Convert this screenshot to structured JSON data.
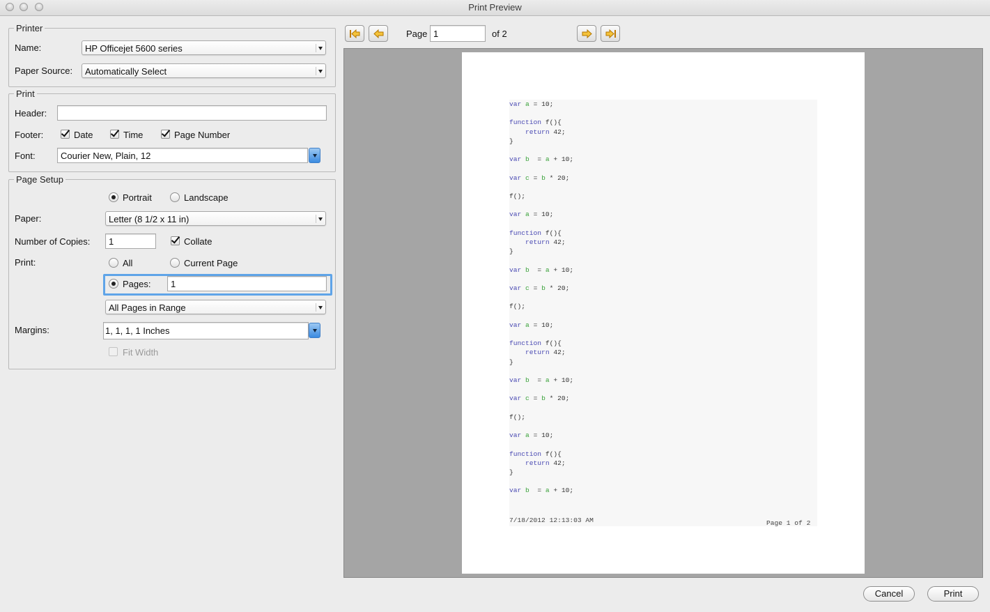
{
  "window": {
    "title": "Print Preview"
  },
  "printer": {
    "group_title": "Printer",
    "name_label": "Name:",
    "name_value": "HP Officejet 5600 series",
    "source_label": "Paper Source:",
    "source_value": "Automatically Select"
  },
  "print_group": {
    "group_title": "Print",
    "header_label": "Header:",
    "header_value": "",
    "footer_label": "Footer:",
    "footer_date": {
      "label": "Date",
      "checked": true
    },
    "footer_time": {
      "label": "Time",
      "checked": true
    },
    "footer_page_number": {
      "label": "Page Number",
      "checked": true
    },
    "font_label": "Font:",
    "font_value": "Courier New, Plain, 12"
  },
  "page_setup": {
    "group_title": "Page Setup",
    "orientation": {
      "portrait": "Portrait",
      "landscape": "Landscape",
      "selected": "Portrait"
    },
    "paper_label": "Paper:",
    "paper_value": "Letter (8 1/2 x 11 in)",
    "copies_label": "Number of Copies:",
    "copies_value": "1",
    "collate": {
      "label": "Collate",
      "checked": true
    },
    "print_label": "Print:",
    "range_all": "All",
    "range_current": "Current Page",
    "range_pages": "Pages:",
    "range_selected": "Pages",
    "pages_value": "1",
    "subset_value": "All Pages in Range",
    "margins_label": "Margins:",
    "margins_value": "1, 1, 1, 1 Inches",
    "fit_width": {
      "label": "Fit Width",
      "checked": false,
      "enabled": false
    }
  },
  "navigation": {
    "page_label": "Page",
    "page_value": "1",
    "of_label": "of 2",
    "icons": [
      "first-page-icon",
      "previous-page-icon",
      "next-page-icon",
      "last-page-icon"
    ]
  },
  "preview": {
    "lines": [
      "var a = 10;",
      "",
      "function f(){",
      "    return 42;",
      "}",
      "",
      "var b  = a + 10;",
      "",
      "var c = b * 20;",
      "",
      "f();",
      "",
      "var a = 10;",
      "",
      "function f(){",
      "    return 42;",
      "}",
      "",
      "var b  = a + 10;",
      "",
      "var c = b * 20;",
      "",
      "f();",
      "",
      "var a = 10;",
      "",
      "function f(){",
      "    return 42;",
      "}",
      "",
      "var b  = a + 10;",
      "",
      "var c = b * 20;",
      "",
      "f();",
      "",
      "var a = 10;",
      "",
      "function f(){",
      "    return 42;",
      "}",
      "",
      "var b  = a + 10;"
    ],
    "footer_left": "7/18/2012 12:13:03 AM",
    "footer_right": "Page 1 of 2"
  },
  "buttons": {
    "cancel": "Cancel",
    "print": "Print"
  },
  "colors": {
    "focus": "#5fa4e8",
    "keyword": "#4a4ab3",
    "identifier": "#3aa23a",
    "preview_bg": "#a5a5a5"
  }
}
